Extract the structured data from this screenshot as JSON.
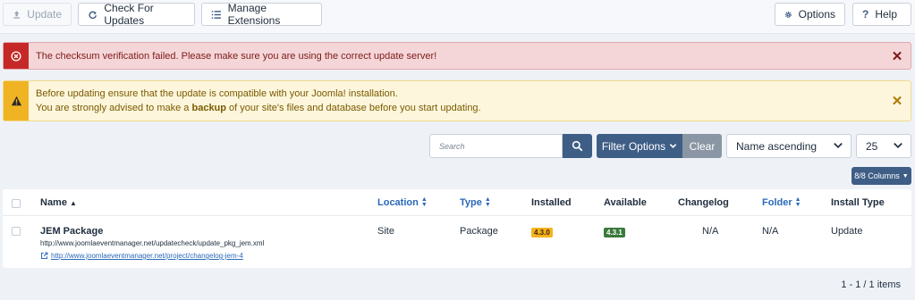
{
  "toolbar": {
    "update_label": "Update",
    "check_updates_label": "Check For Updates",
    "manage_extensions_label": "Manage Extensions",
    "options_label": "Options",
    "help_label": "Help"
  },
  "alerts": {
    "error_message": "The checksum verification failed. Please make sure you are using the correct update server!",
    "warning_line1": "Before updating ensure that the update is compatible with your Joomla! installation.",
    "warning_line2_before": "You are strongly advised to make a ",
    "warning_line2_bold": "backup",
    "warning_line2_after": " of your site's files and database before you start updating."
  },
  "filters": {
    "search_placeholder": "Search",
    "filter_options_label": "Filter Options",
    "clear_label": "Clear",
    "sort_value": "Name ascending",
    "limit_value": "25",
    "columns_label": "8/8 Columns"
  },
  "table": {
    "headers": {
      "name": "Name",
      "location": "Location",
      "type": "Type",
      "installed": "Installed",
      "available": "Available",
      "changelog": "Changelog",
      "folder": "Folder",
      "install_type": "Install Type"
    },
    "row": {
      "name": "JEM Package",
      "url": "http://www.joomlaeventmanager.net/updatecheck/update_pkg_jem.xml",
      "changelog_url": "http://www.joomlaeventmanager.net/project/changelog-jem-4",
      "location": "Site",
      "type": "Package",
      "installed": "4.3.0",
      "available": "4.3.1",
      "changelog": "N/A",
      "folder": "N/A",
      "install_type": "Update"
    }
  },
  "pagination": {
    "info": "1 - 1 / 1 items"
  },
  "colors": {
    "primary": "#3f5e86",
    "danger": "#c52827",
    "warning": "#f0b323",
    "installed_badge": "#f6b21f",
    "available_badge": "#3a7a3c",
    "link": "#2a69b8"
  }
}
